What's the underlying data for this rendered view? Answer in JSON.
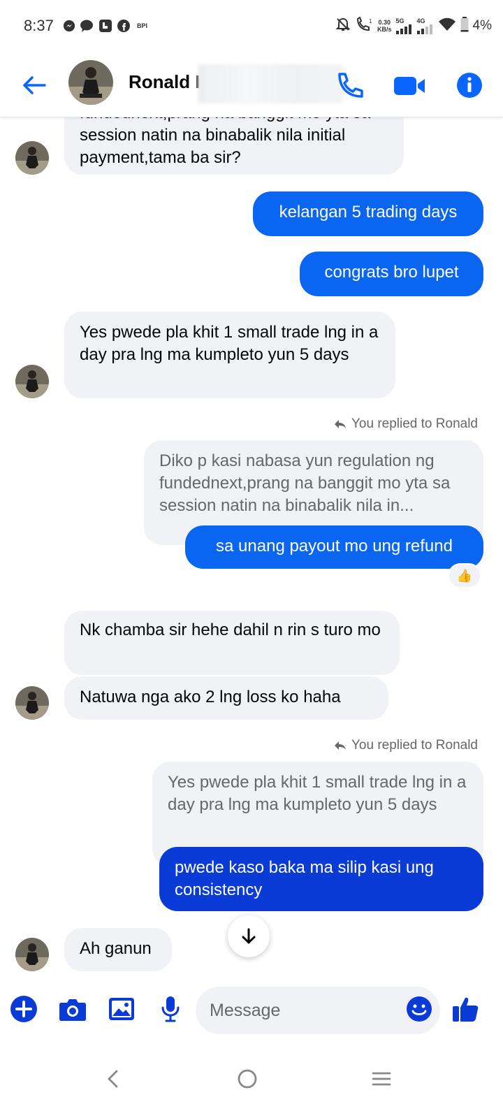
{
  "status_bar": {
    "time": "8:37",
    "bpi": "BPI",
    "speed_value": "0.30",
    "speed_unit": "KB/s",
    "net1": "5G",
    "net2": "4G",
    "battery": "4%"
  },
  "header": {
    "contact_name": "Ronald I"
  },
  "messages": {
    "m1": "fundednext,prang na banggit mo yta sa session natin na binabalik nila initial payment,tama ba sir?",
    "m2": "kelangan 5 trading days",
    "m3": "congrats bro lupet",
    "m4": "Yes pwede pla khit 1 small trade lng in a day pra lng ma kumpleto yun 5 days",
    "reply1_label": "You replied to Ronald",
    "reply1_quote": "Diko p kasi nabasa yun regulation ng fundednext,prang na banggit mo yta sa session natin na binabalik nila in...",
    "m5": "sa unang payout mo ung refund",
    "m5_reaction": "👍",
    "m6": "Nk chamba sir hehe dahil n rin s turo mo",
    "m7": "Natuwa nga ako 2 lng loss ko haha",
    "reply2_label": "You replied to Ronald",
    "reply2_quote": "Yes pwede pla khit 1 small trade lng in a day pra lng ma kumpleto yun 5 days",
    "m8": "pwede kaso baka ma silip kasi ung consistency",
    "m9": "Ah ganun"
  },
  "composer": {
    "placeholder": "Message"
  },
  "colors": {
    "accent": "#0a66f0",
    "outgoing_dark": "#0b3bd6",
    "incoming": "#f0f2f5",
    "icon_blue": "#0866ff"
  }
}
